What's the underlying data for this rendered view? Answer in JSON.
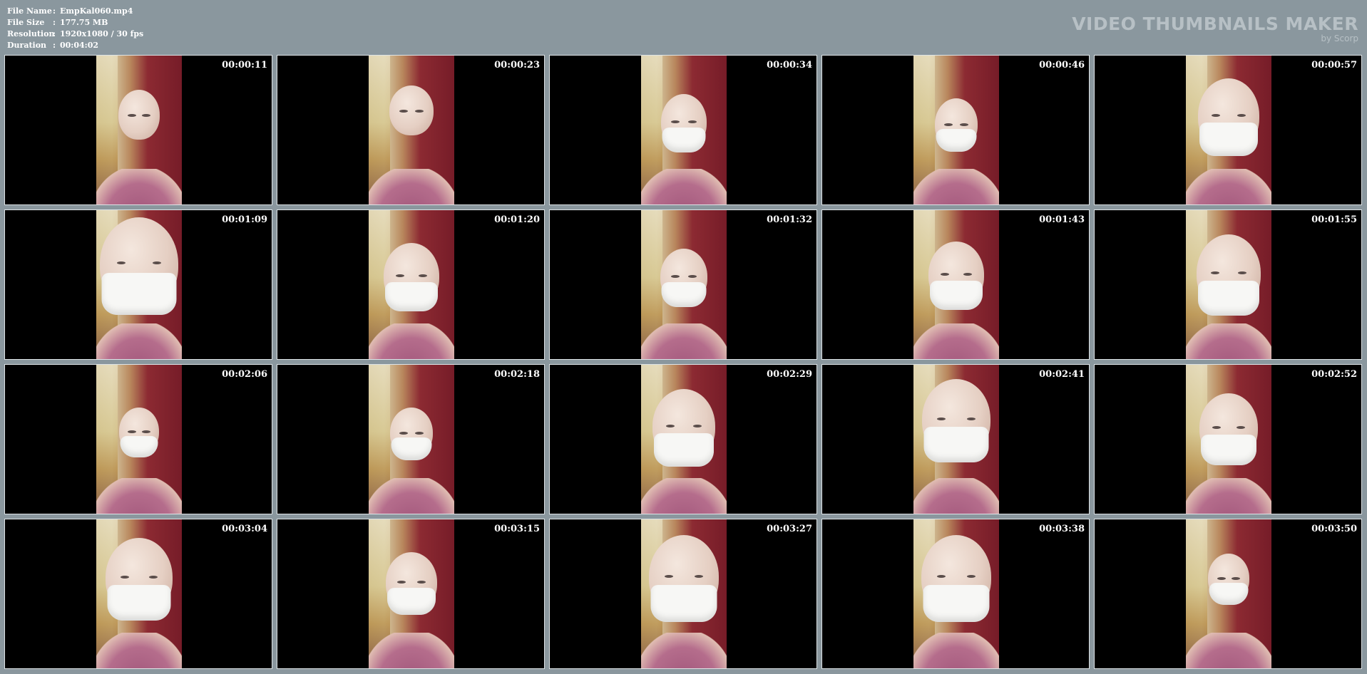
{
  "meta": {
    "rows": [
      {
        "label": "File Name",
        "value": "EmpKal060.mp4"
      },
      {
        "label": "File Size",
        "value": "177.75 MB"
      },
      {
        "label": "Resolution",
        "value": "1920x1080 / 30 fps"
      },
      {
        "label": "Duration",
        "value": "00:04:02"
      }
    ]
  },
  "brand": {
    "title": "VIDEO THUMBNAILS MAKER",
    "by": "by Scorp"
  },
  "thumbs": [
    {
      "time": "00:00:11",
      "mask": false
    },
    {
      "time": "00:00:23",
      "mask": false
    },
    {
      "time": "00:00:34",
      "mask": true
    },
    {
      "time": "00:00:46",
      "mask": true
    },
    {
      "time": "00:00:57",
      "mask": true
    },
    {
      "time": "00:01:09",
      "mask": true
    },
    {
      "time": "00:01:20",
      "mask": true
    },
    {
      "time": "00:01:32",
      "mask": true
    },
    {
      "time": "00:01:43",
      "mask": true
    },
    {
      "time": "00:01:55",
      "mask": true
    },
    {
      "time": "00:02:06",
      "mask": true
    },
    {
      "time": "00:02:18",
      "mask": true
    },
    {
      "time": "00:02:29",
      "mask": true
    },
    {
      "time": "00:02:41",
      "mask": true
    },
    {
      "time": "00:02:52",
      "mask": true
    },
    {
      "time": "00:03:04",
      "mask": true
    },
    {
      "time": "00:03:15",
      "mask": true
    },
    {
      "time": "00:03:27",
      "mask": true
    },
    {
      "time": "00:03:38",
      "mask": true
    },
    {
      "time": "00:03:50",
      "mask": true
    }
  ]
}
